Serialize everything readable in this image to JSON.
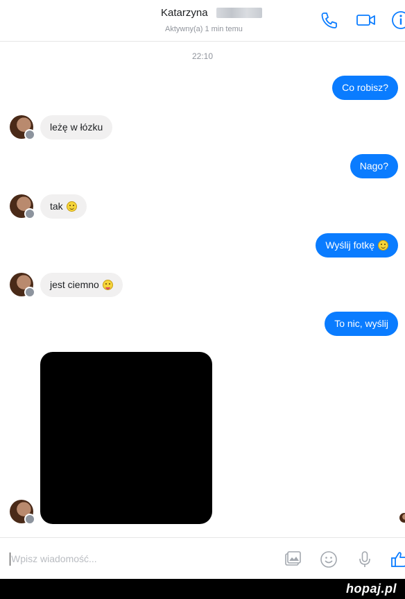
{
  "header": {
    "contact_name": "Katarzyna",
    "status": "Aktywny(a) 1 min temu"
  },
  "conversation": {
    "timestamp": "22:10",
    "messages": [
      {
        "side": "out",
        "text": "Co robisz?"
      },
      {
        "side": "in",
        "text": "leżę w łózku"
      },
      {
        "side": "out",
        "text": "Nago?"
      },
      {
        "side": "in",
        "text": "tak",
        "emoji": "smile-emoji"
      },
      {
        "side": "out",
        "text": "Wyślij fotkę",
        "emoji": "smile-emoji"
      },
      {
        "side": "in",
        "text": "jest ciemno",
        "emoji": "tongue-emoji"
      },
      {
        "side": "out",
        "text": "To nic, wyślij"
      },
      {
        "side": "in",
        "type": "photo",
        "content": "black image"
      }
    ]
  },
  "composer": {
    "placeholder": "Wpisz wiadomość..."
  },
  "icons": [
    "phone-icon",
    "video-icon",
    "info-icon",
    "image-icon",
    "emoji-icon",
    "microphone-icon",
    "like-icon"
  ],
  "colors": {
    "accent": "#0a7cff",
    "incoming_bubble": "#f1f0f0",
    "photo": "#000000"
  },
  "watermark": {
    "text": "hopaj.pl"
  }
}
